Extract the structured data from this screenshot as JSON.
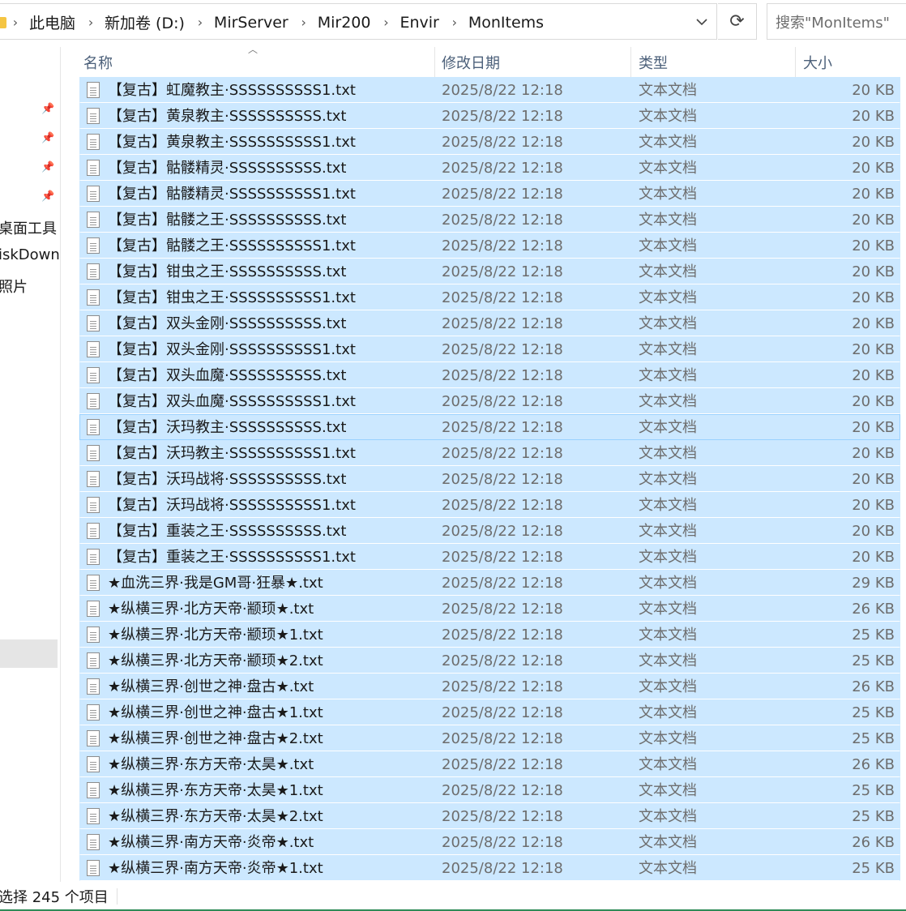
{
  "breadcrumbs": [
    "此电脑",
    "新加卷 (D:)",
    "MirServer",
    "Mir200",
    "Envir",
    "MonItems"
  ],
  "search_placeholder": "搜索\"MonItems\"",
  "nav": {
    "items": [
      "桌面工具",
      "iskDown",
      "照片"
    ]
  },
  "columns": {
    "name": "名称",
    "date": "修改日期",
    "type": "类型",
    "size": "大小"
  },
  "files": [
    {
      "name": "【复古】虹魔教主·SSSSSSSSSS1.txt",
      "date": "2025/8/22 12:18",
      "type": "文本文档",
      "size": "20 KB"
    },
    {
      "name": "【复古】黄泉教主·SSSSSSSSSS.txt",
      "date": "2025/8/22 12:18",
      "type": "文本文档",
      "size": "20 KB"
    },
    {
      "name": "【复古】黄泉教主·SSSSSSSSSS1.txt",
      "date": "2025/8/22 12:18",
      "type": "文本文档",
      "size": "20 KB"
    },
    {
      "name": "【复古】骷髅精灵·SSSSSSSSSS.txt",
      "date": "2025/8/22 12:18",
      "type": "文本文档",
      "size": "20 KB"
    },
    {
      "name": "【复古】骷髅精灵·SSSSSSSSSS1.txt",
      "date": "2025/8/22 12:18",
      "type": "文本文档",
      "size": "20 KB"
    },
    {
      "name": "【复古】骷髅之王·SSSSSSSSSS.txt",
      "date": "2025/8/22 12:18",
      "type": "文本文档",
      "size": "20 KB"
    },
    {
      "name": "【复古】骷髅之王·SSSSSSSSSS1.txt",
      "date": "2025/8/22 12:18",
      "type": "文本文档",
      "size": "20 KB"
    },
    {
      "name": "【复古】钳虫之王·SSSSSSSSSS.txt",
      "date": "2025/8/22 12:18",
      "type": "文本文档",
      "size": "20 KB"
    },
    {
      "name": "【复古】钳虫之王·SSSSSSSSSS1.txt",
      "date": "2025/8/22 12:18",
      "type": "文本文档",
      "size": "20 KB"
    },
    {
      "name": "【复古】双头金刚·SSSSSSSSSS.txt",
      "date": "2025/8/22 12:18",
      "type": "文本文档",
      "size": "20 KB"
    },
    {
      "name": "【复古】双头金刚·SSSSSSSSSS1.txt",
      "date": "2025/8/22 12:18",
      "type": "文本文档",
      "size": "20 KB"
    },
    {
      "name": "【复古】双头血魔·SSSSSSSSSS.txt",
      "date": "2025/8/22 12:18",
      "type": "文本文档",
      "size": "20 KB"
    },
    {
      "name": "【复古】双头血魔·SSSSSSSSSS1.txt",
      "date": "2025/8/22 12:18",
      "type": "文本文档",
      "size": "20 KB"
    },
    {
      "name": "【复古】沃玛教主·SSSSSSSSSS.txt",
      "date": "2025/8/22 12:18",
      "type": "文本文档",
      "size": "20 KB"
    },
    {
      "name": "【复古】沃玛教主·SSSSSSSSSS1.txt",
      "date": "2025/8/22 12:18",
      "type": "文本文档",
      "size": "20 KB"
    },
    {
      "name": "【复古】沃玛战将·SSSSSSSSSS.txt",
      "date": "2025/8/22 12:18",
      "type": "文本文档",
      "size": "20 KB"
    },
    {
      "name": "【复古】沃玛战将·SSSSSSSSSS1.txt",
      "date": "2025/8/22 12:18",
      "type": "文本文档",
      "size": "20 KB"
    },
    {
      "name": "【复古】重装之王·SSSSSSSSSS.txt",
      "date": "2025/8/22 12:18",
      "type": "文本文档",
      "size": "20 KB"
    },
    {
      "name": "【复古】重装之王·SSSSSSSSSS1.txt",
      "date": "2025/8/22 12:18",
      "type": "文本文档",
      "size": "20 KB"
    },
    {
      "name": "★血洗三界·我是GM哥·狂暴★.txt",
      "date": "2025/8/22 12:18",
      "type": "文本文档",
      "size": "29 KB"
    },
    {
      "name": "★纵横三界·北方天帝·颛顼★.txt",
      "date": "2025/8/22 12:18",
      "type": "文本文档",
      "size": "26 KB"
    },
    {
      "name": "★纵横三界·北方天帝·颛顼★1.txt",
      "date": "2025/8/22 12:18",
      "type": "文本文档",
      "size": "25 KB"
    },
    {
      "name": "★纵横三界·北方天帝·颛顼★2.txt",
      "date": "2025/8/22 12:18",
      "type": "文本文档",
      "size": "25 KB"
    },
    {
      "name": "★纵横三界·创世之神·盘古★.txt",
      "date": "2025/8/22 12:18",
      "type": "文本文档",
      "size": "26 KB"
    },
    {
      "name": "★纵横三界·创世之神·盘古★1.txt",
      "date": "2025/8/22 12:18",
      "type": "文本文档",
      "size": "25 KB"
    },
    {
      "name": "★纵横三界·创世之神·盘古★2.txt",
      "date": "2025/8/22 12:18",
      "type": "文本文档",
      "size": "25 KB"
    },
    {
      "name": "★纵横三界·东方天帝·太昊★.txt",
      "date": "2025/8/22 12:18",
      "type": "文本文档",
      "size": "26 KB"
    },
    {
      "name": "★纵横三界·东方天帝·太昊★1.txt",
      "date": "2025/8/22 12:18",
      "type": "文本文档",
      "size": "25 KB"
    },
    {
      "name": "★纵横三界·东方天帝·太昊★2.txt",
      "date": "2025/8/22 12:18",
      "type": "文本文档",
      "size": "25 KB"
    },
    {
      "name": "★纵横三界·南方天帝·炎帝★.txt",
      "date": "2025/8/22 12:18",
      "type": "文本文档",
      "size": "26 KB"
    },
    {
      "name": "★纵横三界·南方天帝·炎帝★1.txt",
      "date": "2025/8/22 12:18",
      "type": "文本文档",
      "size": "25 KB"
    }
  ],
  "status": {
    "text": "选择 245 个项目"
  },
  "colors": {
    "selection": "#cce8ff",
    "focus_border": "#99d1ff",
    "header_text": "#4c607a"
  }
}
